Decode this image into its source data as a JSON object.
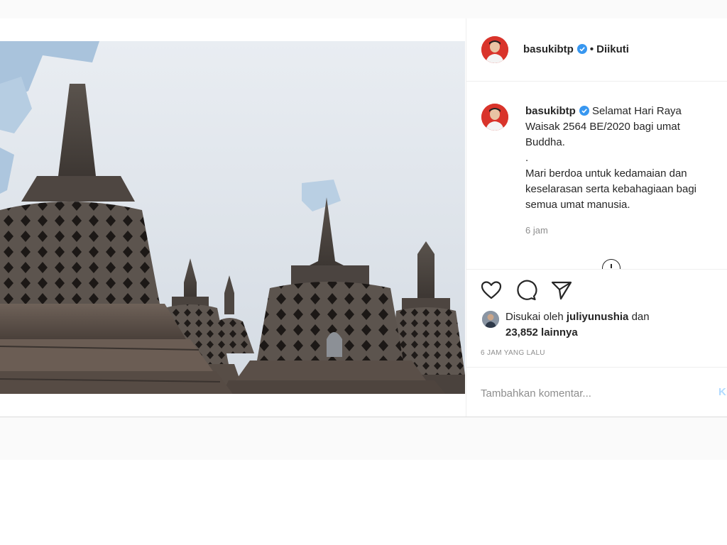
{
  "post": {
    "image_alt": "Borobudur stupas",
    "username": "basukibtp",
    "verified": true,
    "follow_separator": "•",
    "follow_status": "Diikuti",
    "caption": {
      "username": "basukibtp",
      "lines": [
        "Selamat Hari Raya",
        "Waisak 2564 BE/2020 bagi umat",
        "Buddha.",
        ".",
        "Mari berdoa untuk kedamaian dan",
        "keselarasan serta kebahagiaan bagi",
        "semua umat manusia."
      ],
      "time": "6 jam"
    },
    "likes": {
      "prefix": "Disukai oleh",
      "liker": "juliyunushia",
      "connector": "dan",
      "count_text": "23,852 lainnya"
    },
    "timestamp": "6 JAM YANG LALU",
    "comment": {
      "placeholder": "Tambahkan komentar...",
      "post_label": "Kirim"
    }
  },
  "icons": {
    "like": "heart-icon",
    "comment": "comment-icon",
    "share": "paper-plane-icon",
    "verified": "verified-badge-icon",
    "more": "more-replies-icon"
  },
  "colors": {
    "verified_blue": "#3897f0",
    "secondary_text": "#8e8e8e",
    "post_button_disabled": "#b3dbff",
    "avatar_red": "#d9342b"
  }
}
